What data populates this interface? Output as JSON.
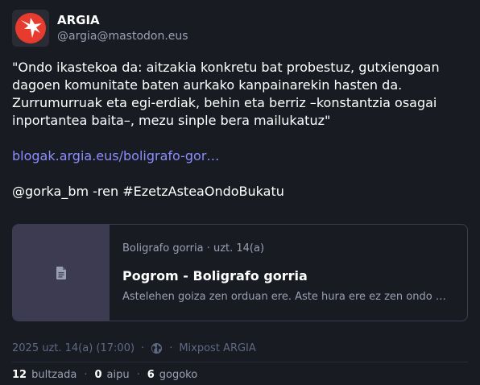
{
  "author": {
    "display_name": "ARGIA",
    "handle": "@argia@mastodon.eus"
  },
  "post": {
    "paragraph_1": "\"Ondo ikastekoa da: aitzakia konkretu bat probestuz, gutxiengoan dagoen komunitate baten aurkako kanpainarekin hasten da. Zurrumurruak eta egi-erdiak, behin eta berriz –konstantzia osagai inportantea baita–, mezu sinple bera mailukatuz\"",
    "link_text": "blogak.argia.eus/boligrafo-gor…",
    "mention": "@gorka_bm",
    "ren_text": " -ren ",
    "hashtag": "#EzetzAsteaOndoBukatu"
  },
  "card": {
    "meta": "Boligrafo gorria · uzt. 14(a)",
    "title": "Pogrom - Boligrafo gorria",
    "description": "Astelehen goiza zen orduan ere. Aste hura ere ez zen ondo bukatu."
  },
  "meta": {
    "timestamp": "2025 uzt. 14(a) (17:00)",
    "separator": "·",
    "application": "Mixpost ARGIA"
  },
  "stats": {
    "boosts_count": "12",
    "boosts_label": "bultzada",
    "replies_count": "0",
    "replies_label": "aipu",
    "favourites_count": "6",
    "favourites_label": "gogoko",
    "separator": "·"
  },
  "colors": {
    "background": "#191b22",
    "link": "#8c8dff",
    "muted": "#9aa0b4",
    "avatar_red": "#e63b2e"
  },
  "icons": {
    "avatar": "argia-logo-icon",
    "card_thumbnail": "document-icon",
    "visibility": "globe-icon"
  }
}
